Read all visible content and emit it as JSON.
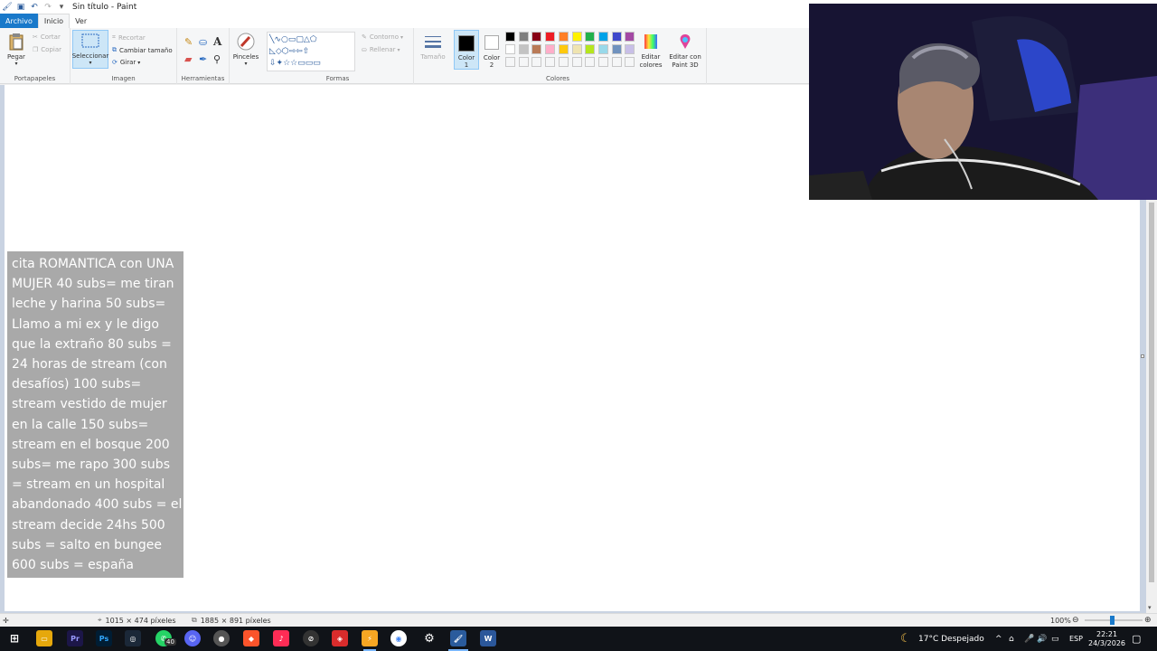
{
  "window": {
    "title": "Sin título - Paint"
  },
  "tabs": [
    {
      "label": "Archivo"
    },
    {
      "label": "Inicio"
    },
    {
      "label": "Ver"
    }
  ],
  "ribbon": {
    "clipboard": {
      "paste": "Pegar",
      "cut": "Cortar",
      "copy": "Copiar",
      "group_label": "Portapapeles"
    },
    "image": {
      "select": "Seleccionar",
      "crop": "Recortar",
      "resize": "Cambiar tamaño",
      "rotate": "Girar",
      "group_label": "Imagen"
    },
    "tools": {
      "group_label": "Herramientas",
      "brushes": "Pinceles"
    },
    "shapes": {
      "outline": "Contorno",
      "fill": "Rellenar",
      "group_label": "Formas"
    },
    "size": "Tamaño",
    "color1": "Color 1",
    "color2": "Color 2",
    "colors": {
      "group_label": "Colores",
      "edit_colors": "Editar colores",
      "paint3d": "Editar con Paint 3D",
      "palette_row1": [
        "#000000",
        "#7f7f7f",
        "#880015",
        "#ed1c24",
        "#ff7f27",
        "#fff200",
        "#22b14c",
        "#00a2e8",
        "#3f48cc",
        "#a349a4"
      ],
      "palette_row2": [
        "#ffffff",
        "#c3c3c3",
        "#b97a57",
        "#ffaec9",
        "#ffc90e",
        "#efe4b0",
        "#b5e61d",
        "#99d9ea",
        "#7092be",
        "#c8bfe7"
      ]
    }
  },
  "canvas": {
    "text": "cita ROMANTICA con UNA MUJER 40 subs= me tiran leche y harina 50 subs= Llamo a mi ex y le digo que la extraño 80 subs = 24 horas de stream (con desafíos) 100 subs= stream vestido de mujer en la calle 150 subs= stream en el bosque 200 subs= me rapo 300 subs = stream en un hospital abandonado 400 subs = el stream decide 24hs 500 subs = salto en bungee 600 subs = españa"
  },
  "status": {
    "cursor_pos": "1015 × 474 píxeles",
    "image_size": "1885 × 891 píxeles",
    "zoom": "100%"
  },
  "taskbar": {
    "whatsapp_badge": "40",
    "weather": "17°C  Despejado",
    "lang": "ESP",
    "time": "22:21",
    "date": "24/3/2026"
  }
}
